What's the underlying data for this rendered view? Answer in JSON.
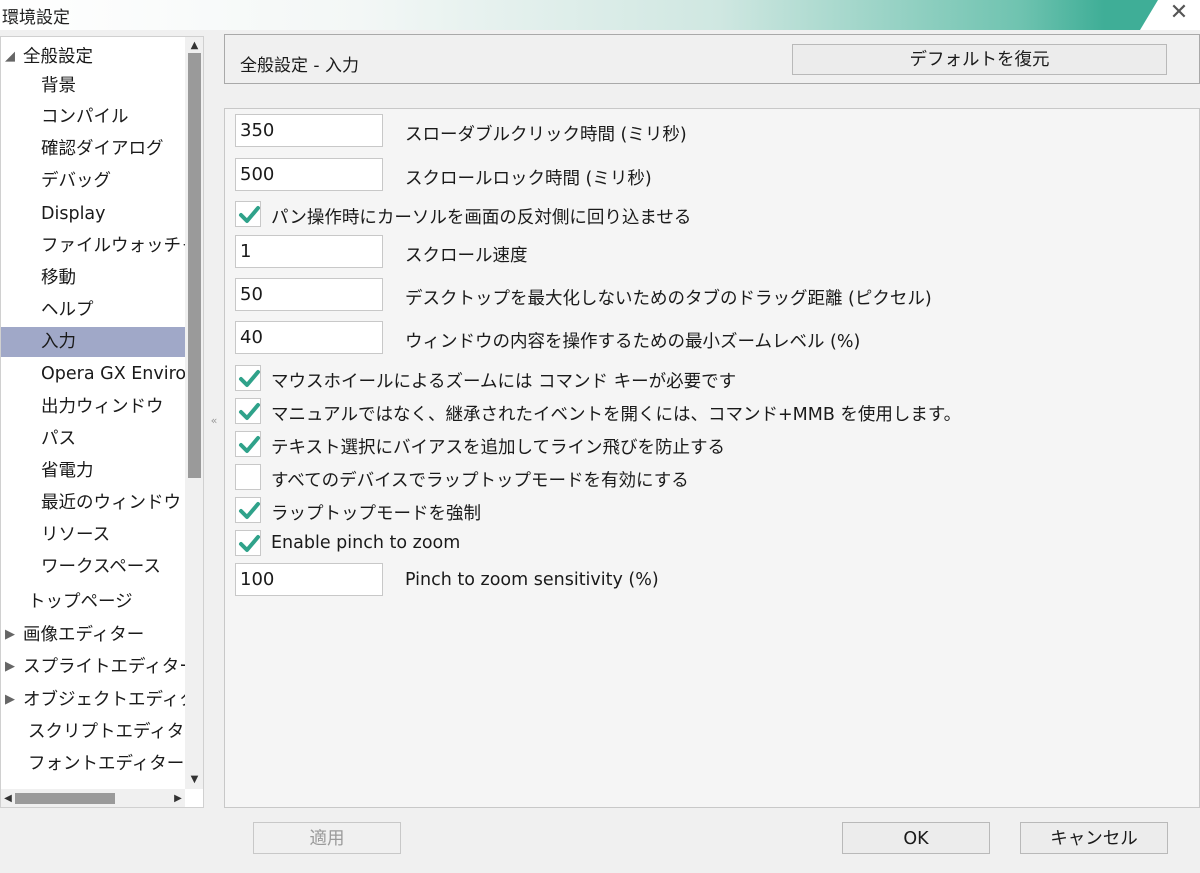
{
  "window": {
    "title": "環境設定",
    "close_glyph": "✕"
  },
  "tree": {
    "items": [
      {
        "label": "全般設定",
        "arrow": "◢"
      },
      {
        "label": "背景"
      },
      {
        "label": "コンパイル"
      },
      {
        "label": "確認ダイアログ"
      },
      {
        "label": "デバッグ"
      },
      {
        "label": "Display"
      },
      {
        "label": "ファイルウォッチャー"
      },
      {
        "label": "移動"
      },
      {
        "label": "ヘルプ"
      },
      {
        "label": "入力",
        "selected": true
      },
      {
        "label": "Opera GX Environment"
      },
      {
        "label": "出力ウィンドウ"
      },
      {
        "label": "パス"
      },
      {
        "label": "省電力"
      },
      {
        "label": "最近のウィンドウ"
      },
      {
        "label": "リソース"
      },
      {
        "label": "ワークスペース"
      },
      {
        "label": "トップページ"
      },
      {
        "label": "画像エディター",
        "arrow": "▶"
      },
      {
        "label": "スプライトエディター",
        "arrow": "▶"
      },
      {
        "label": "オブジェクトエディター",
        "arrow": "▶"
      },
      {
        "label": "スクリプトエディター"
      },
      {
        "label": "フォントエディター"
      }
    ],
    "splitter_glyph": "«"
  },
  "header": {
    "title": "全般設定 - 入力",
    "restore_label": "デフォルトを復元"
  },
  "settings": [
    {
      "type": "field",
      "value": "350",
      "label": "スローダブルクリック時間 (ミリ秒)"
    },
    {
      "type": "field",
      "value": "500",
      "label": "スクロールロック時間 (ミリ秒)"
    },
    {
      "type": "check",
      "checked": true,
      "label": "パン操作時にカーソルを画面の反対側に回り込ませる"
    },
    {
      "type": "field",
      "value": "1",
      "label": "スクロール速度"
    },
    {
      "type": "field",
      "value": "50",
      "label": "デスクトップを最大化しないためのタブのドラッグ距離 (ピクセル)"
    },
    {
      "type": "field",
      "value": "40",
      "label": "ウィンドウの内容を操作するための最小ズームレベル (%)"
    },
    {
      "type": "check",
      "checked": true,
      "label": "マウスホイールによるズームには コマンド キーが必要です"
    },
    {
      "type": "check",
      "checked": true,
      "label": "マニュアルではなく、継承されたイベントを開くには、コマンド+MMB を使用します。"
    },
    {
      "type": "check",
      "checked": true,
      "label": "テキスト選択にバイアスを追加してライン飛びを防止する"
    },
    {
      "type": "check",
      "checked": false,
      "label": "すべてのデバイスでラップトップモードを有効にする"
    },
    {
      "type": "check",
      "checked": true,
      "label": "ラップトップモードを強制"
    },
    {
      "type": "check",
      "checked": true,
      "label": "Enable pinch to zoom"
    },
    {
      "type": "field",
      "value": "100",
      "label": "Pinch to zoom sensitivity (%)"
    }
  ],
  "footer": {
    "apply_label": "適用",
    "ok_label": "OK",
    "cancel_label": "キャンセル"
  },
  "colors": {
    "accent": "#3fae97",
    "checkmark": "#2fa28a",
    "selection": "#a0a8c8"
  }
}
